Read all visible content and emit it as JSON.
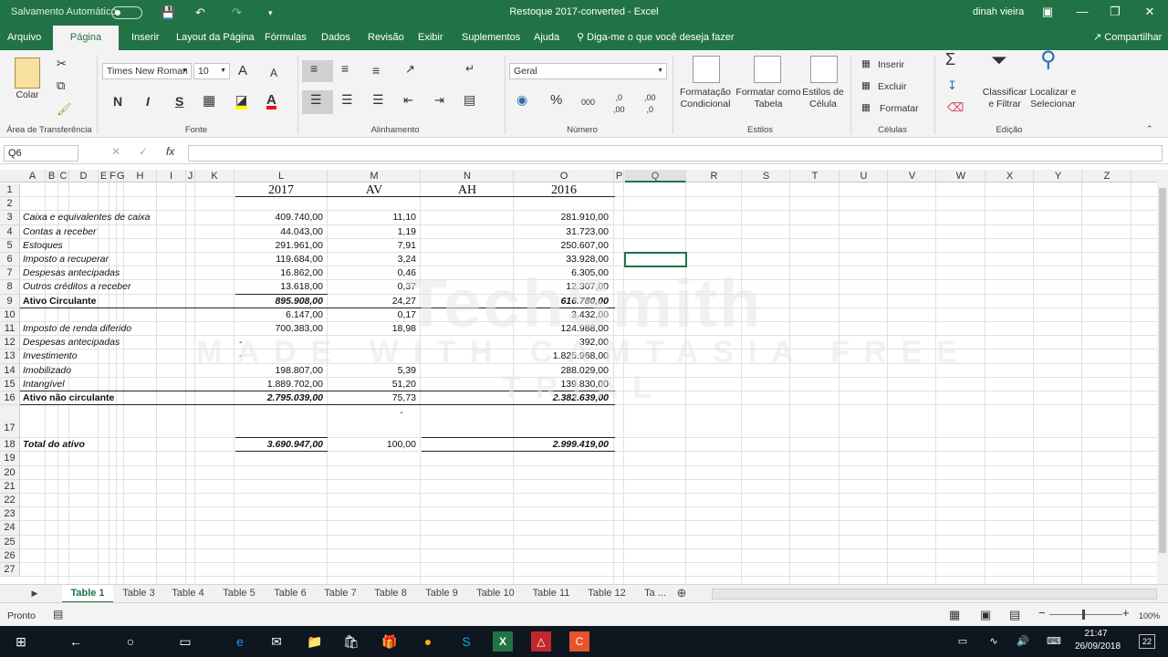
{
  "titlebar": {
    "autosave": "Salvamento Automático",
    "title": "Restoque 2017-converted  -  Excel",
    "user": "dinah vieira",
    "icons": [
      "save-icon",
      "undo-icon",
      "redo-icon",
      "customize-icon"
    ]
  },
  "tabs": [
    "Arquivo",
    "Página Inicial",
    "Inserir",
    "Layout da Página",
    "Fórmulas",
    "Dados",
    "Revisão",
    "Exibir",
    "Suplementos",
    "Ajuda"
  ],
  "tell_me": "Diga-me o que você deseja fazer",
  "share": "Compartilhar",
  "ribbon": {
    "clipboard": {
      "paste": "Colar",
      "label": "Área de Transferência"
    },
    "font": {
      "name": "Times New Roman",
      "size": "10",
      "bold": "N",
      "italic": "I",
      "underline": "S",
      "label": "Fonte",
      "grow": "A",
      "shrink": "A"
    },
    "alignment": {
      "label": "Alinhamento"
    },
    "number": {
      "format": "Geral",
      "percent": "%",
      "thousands": "000",
      "inc_dec": ",0\n,00",
      "dec_dec": ",00\n,0",
      "label": "Número"
    },
    "styles": {
      "cond": "Formatação Condicional",
      "table": "Formatar como Tabela",
      "cell": "Estilos de Célula",
      "label": "Estilos"
    },
    "cells": {
      "insert": "Inserir",
      "delete": "Excluir",
      "format": "Formatar",
      "label": "Células"
    },
    "editing": {
      "sort": "Classificar e Filtrar",
      "find": "Localizar e Selecionar",
      "label": "Edição",
      "sigma": "Σ"
    }
  },
  "formula_bar": {
    "namebox": "Q6",
    "fx": "fx",
    "value": ""
  },
  "columns": [
    "A",
    "B",
    "C",
    "D",
    "E",
    "F",
    "G",
    "H",
    "I",
    "J",
    "K",
    "L",
    "M",
    "N",
    "O",
    "P",
    "Q",
    "R",
    "S",
    "T",
    "U",
    "V",
    "W",
    "X",
    "Y",
    "Z"
  ],
  "selected_cell": "Q6",
  "rows": [
    "1",
    "2",
    "3",
    "4",
    "5",
    "6",
    "7",
    "8",
    "9",
    "10",
    "11",
    "12",
    "13",
    "14",
    "15",
    "16",
    "17",
    "18",
    "19",
    "20",
    "21",
    "22",
    "23",
    "24",
    "25",
    "26",
    "27"
  ],
  "sheet": {
    "headers": {
      "L": "2017",
      "M": "AV",
      "N": "AH",
      "O": "2016"
    },
    "lines": [
      {
        "row": 3,
        "label": "Caixa e equivalentes de caixa",
        "l": "409.740,00",
        "m": "11,10",
        "o": "281.910,00"
      },
      {
        "row": 4,
        "label": "Contas a receber",
        "l": "44.043,00",
        "m": "1,19",
        "o": "31.723,00"
      },
      {
        "row": 5,
        "label": "Estoques",
        "l": "291.961,00",
        "m": "7,91",
        "o": "250.607,00"
      },
      {
        "row": 6,
        "label": "Imposto a recuperar",
        "l": "119.684,00",
        "m": "3,24",
        "o": "33.928,00"
      },
      {
        "row": 7,
        "label": "Despesas antecipadas",
        "l": "16.862,00",
        "m": "0,46",
        "o": "6.305,00"
      },
      {
        "row": 8,
        "label": "Outros créditos a receber",
        "l": "13.618,00",
        "m": "0,37",
        "o": "12.307,00"
      },
      {
        "row": 9,
        "label": "Ativo Circulante",
        "l": "895.908,00",
        "m": "24,27",
        "o": "616.780,00",
        "bold": true
      },
      {
        "row": 10,
        "label": "",
        "l": "6.147,00",
        "m": "0,17",
        "o": "3.432,00"
      },
      {
        "row": 11,
        "label": "Imposto de renda diferido",
        "l": "700.383,00",
        "m": "18,98",
        "o": "124.988,00"
      },
      {
        "row": 12,
        "label": "Despesas antecipadas",
        "l": "-",
        "m": "",
        "o": "392,00"
      },
      {
        "row": 13,
        "label": "Investimento",
        "l": "-",
        "m": "",
        "o": "1.825.968,00"
      },
      {
        "row": 14,
        "label": "Imobilizado",
        "l": "198.807,00",
        "m": "5,39",
        "o": "288.029,00"
      },
      {
        "row": 15,
        "label": "Intangível",
        "l": "1.889.702,00",
        "m": "51,20",
        "o": "139.830,00"
      },
      {
        "row": 16,
        "label": "Ativo não circulante",
        "l": "2.795.039,00",
        "m": "75,73",
        "o": "2.382.639,00",
        "bold": true
      },
      {
        "row": 17,
        "label": "",
        "l": "",
        "m": "-",
        "o": ""
      },
      {
        "row": 18,
        "label": "Total do ativo",
        "l": "3.690.947,00",
        "m": "100,00",
        "o": "2.999.419,00",
        "bold": true
      }
    ]
  },
  "sheet_tabs": [
    "Table 1",
    "Table 3",
    "Table 4",
    "Table 5",
    "Table 6",
    "Table 7",
    "Table 8",
    "Table 9",
    "Table 10",
    "Table 11",
    "Table 12",
    "Ta ..."
  ],
  "status": {
    "ready": "Pronto",
    "zoom": "100%"
  },
  "watermark": {
    "logo": "TechSmith",
    "sub": "MADE WITH CAMTASIA FREE TRIAL"
  },
  "taskbar": {
    "time": "21:47",
    "date": "26/09/2018",
    "notif": "22"
  }
}
